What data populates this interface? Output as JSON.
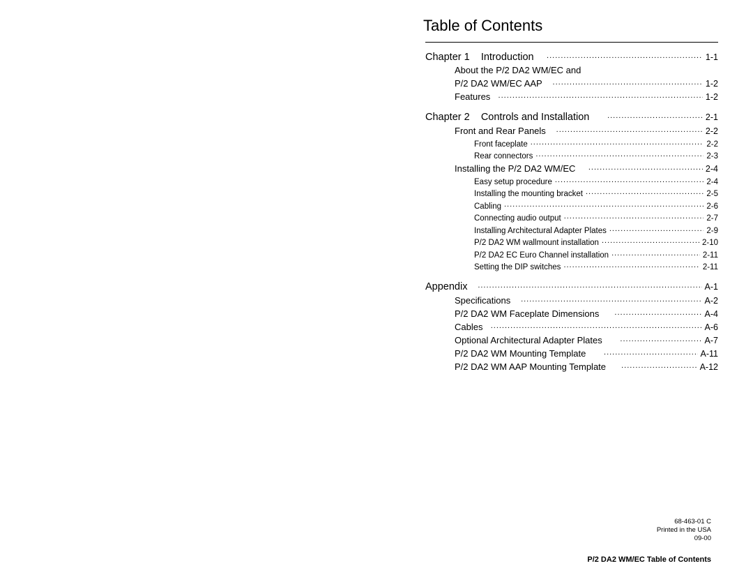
{
  "title": "Table of Contents",
  "toc": {
    "ch1": {
      "heading_prefix": "Chapter 1",
      "heading_title": "Introduction",
      "heading_page": "1-1",
      "items": [
        {
          "label_line1": "About the P/2 DA2 WM/EC and",
          "label_line2": "P/2 DA2 WM/EC AAP",
          "page": "1-2"
        },
        {
          "label": "Features",
          "page": "1-2"
        }
      ]
    },
    "ch2": {
      "heading_prefix": "Chapter 2",
      "heading_title": "Controls and Installation",
      "heading_page": "2-1",
      "sect1": {
        "label": "Front and Rear Panels",
        "page": "2-2",
        "subs": [
          {
            "label": "Front faceplate",
            "page": "2-2"
          },
          {
            "label": "Rear connectors",
            "page": "2-3"
          }
        ]
      },
      "sect2": {
        "label": "Installing the P/2 DA2 WM/EC",
        "page": "2-4",
        "subs": [
          {
            "label": "Easy setup procedure",
            "page": "2-4"
          },
          {
            "label": "Installing the mounting bracket",
            "page": "2-5"
          },
          {
            "label": "Cabling",
            "page": "2-6"
          },
          {
            "label": "Connecting audio output",
            "page": "2-7"
          },
          {
            "label": "Installing Architectural Adapter Plates",
            "page": "2-9"
          },
          {
            "label": "P/2 DA2 WM wallmount installation",
            "page": "2-10"
          },
          {
            "label": "P/2 DA2 EC Euro Channel installation",
            "page": "2-11"
          },
          {
            "label": "Setting the DIP switches",
            "page": "2-11"
          }
        ]
      }
    },
    "appendix": {
      "heading_title": "Appendix",
      "heading_page": "A-1",
      "items": [
        {
          "label": "Specifications",
          "page": "A-2"
        },
        {
          "label": "P/2 DA2 WM Faceplate Dimensions",
          "page": "A-4"
        },
        {
          "label": "Cables",
          "page": "A-6"
        },
        {
          "label": "Optional Architectural Adapter Plates",
          "page": "A-7"
        },
        {
          "label": "P/2 DA2 WM Mounting Template",
          "page": "A-11"
        },
        {
          "label": "P/2 DA2 WM AAP Mounting Template",
          "page": "A-12"
        }
      ]
    }
  },
  "footer": {
    "docnum": "68-463-01 C",
    "printed": "Printed in the USA",
    "date": "09-00",
    "title": "P/2 DA2 WM/EC Table of Contents"
  }
}
